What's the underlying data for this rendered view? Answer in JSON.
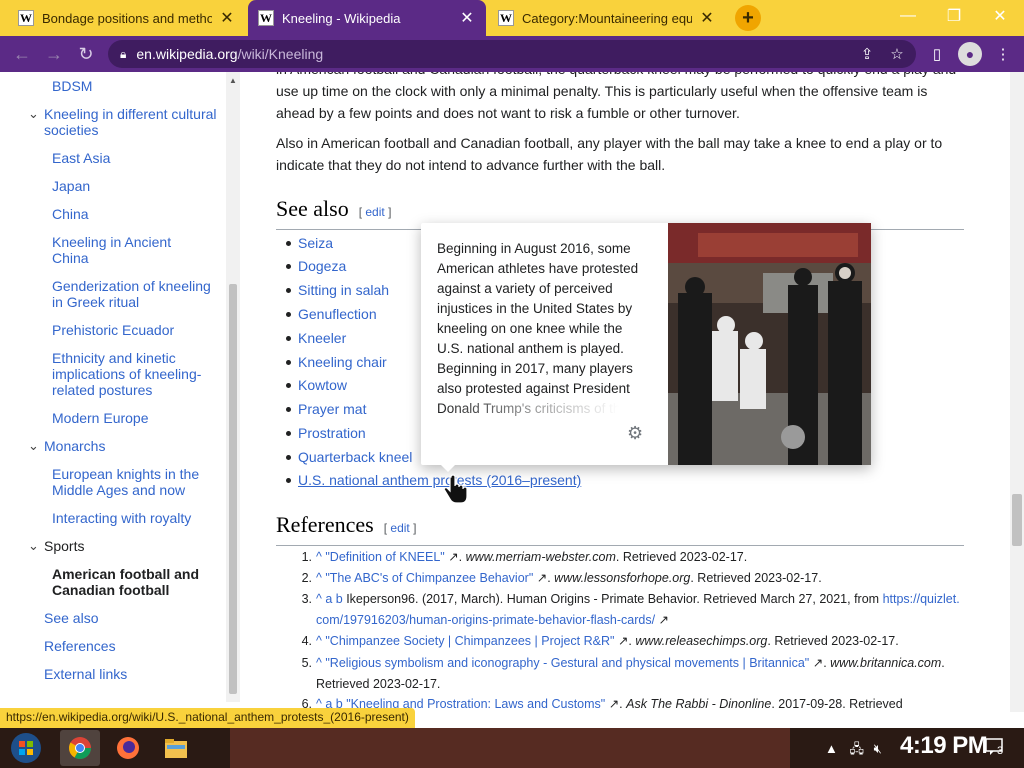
{
  "browser": {
    "tabs": [
      {
        "title": "Bondage positions and methods",
        "active": false
      },
      {
        "title": "Kneeling - Wikipedia",
        "active": true
      },
      {
        "title": "Category:Mountaineering equip",
        "active": false
      }
    ],
    "new_tab_label": "+",
    "url_host": "en.wikipedia.org",
    "url_path": "/wiki/Kneeling",
    "status_url": "https://en.wikipedia.org/wiki/U.S._national_anthem_protests_(2016-present)",
    "colors": {
      "tab_strip": "#f9d23c",
      "toolbar": "#5b2a86"
    }
  },
  "toc": {
    "items": [
      {
        "label": "BDSM",
        "level": 2
      },
      {
        "label": "Kneeling in different cultural societies",
        "level": 1,
        "expanded": true
      },
      {
        "label": "East Asia",
        "level": 2
      },
      {
        "label": "Japan",
        "level": 2
      },
      {
        "label": "China",
        "level": 2
      },
      {
        "label": "Kneeling in Ancient China",
        "level": 2
      },
      {
        "label": "Genderization of kneeling in Greek ritual",
        "level": 2
      },
      {
        "label": "Prehistoric Ecuador",
        "level": 2
      },
      {
        "label": "Ethnicity and kinetic implications of kneeling-related postures",
        "level": 2
      },
      {
        "label": "Modern Europe",
        "level": 2
      },
      {
        "label": "Monarchs",
        "level": 1,
        "expanded": true
      },
      {
        "label": "European knights in the Middle Ages and now",
        "level": 2
      },
      {
        "label": "Interacting with royalty",
        "level": 2
      },
      {
        "label": "Sports",
        "level": 1,
        "expanded": true
      },
      {
        "label": "American football and Canadian football",
        "level": 2,
        "current": true
      },
      {
        "label": "See also",
        "level": 1
      },
      {
        "label": "References",
        "level": 1
      },
      {
        "label": "External links",
        "level": 1
      }
    ]
  },
  "article": {
    "para1_line1": "in American football and Canadian football, the quarterback kneel may be performed to quickly end a play and",
    "para1_line2": "use up time on the clock with only a minimal penalty. This is particularly useful when the offensive team is",
    "para1_line3": "ahead by a few points and does not want to risk a fumble or other turnover.",
    "para2_line1": "Also in American football and Canadian football, any player with the ball may take a knee to end a play or to",
    "para2_line2": "indicate that they do not intend to advance further with the ball.",
    "see_also_heading": "See also",
    "edit_label": "edit",
    "see_also": [
      "Seiza",
      "Dogeza",
      "Sitting in salah",
      "Genuflection",
      "Kneeler",
      "Kneeling chair",
      "Kowtow",
      "Prayer mat",
      "Prostration",
      "Quarterback kneel",
      "U.S. national anthem protests (2016–present)"
    ],
    "references_heading": "References",
    "references": [
      {
        "n": "1.",
        "caret": "^",
        "link": "\"Definition of KNEEL\"",
        "site": "www.merriam-webster.com",
        "tail": ". Retrieved 2023-02-17."
      },
      {
        "n": "2.",
        "caret": "^",
        "link": "\"The ABC's of Chimpanzee Behavior\"",
        "site": "www.lessonsforhope.org",
        "tail": ". Retrieved 2023-02-17."
      },
      {
        "n": "3.",
        "caret": "^ a b",
        "text": "Ikeperson96. (2017, March). Human Origins - Primate Behavior. Retrieved March 27, 2021, from ",
        "link": "https://quizlet.",
        "link2": "com/197916203/human-origins-primate-behavior-flash-cards/"
      },
      {
        "n": "4.",
        "caret": "^",
        "link": "\"Chimpanzee Society | Chimpanzees | Project R&R\"",
        "site": "www.releasechimps.org",
        "tail": ". Retrieved 2023-02-17."
      },
      {
        "n": "5.",
        "caret": "^",
        "link": "\"Religious symbolism and iconography - Gestural and physical movements | Britannica\"",
        "site": "www.britannica.com",
        "tail": ".",
        "line2": "Retrieved 2023-02-17."
      },
      {
        "n": "6.",
        "caret": "^ a b",
        "link": "\"Kneeling and Prostration: Laws and Customs\"",
        "site": "Ask The Rabbi - Dinonline",
        "tail": ". 2017-09-28. Retrieved"
      }
    ]
  },
  "popup": {
    "text": "Beginning in August 2016, some American athletes have protested against a variety of perceived injustices in the United States by kneeling on one knee while the U.S. national anthem is played. Beginning in 2017, many players also protested against President Donald Trump's criticisms of the protests."
  },
  "taskbar": {
    "clock": "4:19 PM",
    "notifications": "3"
  }
}
